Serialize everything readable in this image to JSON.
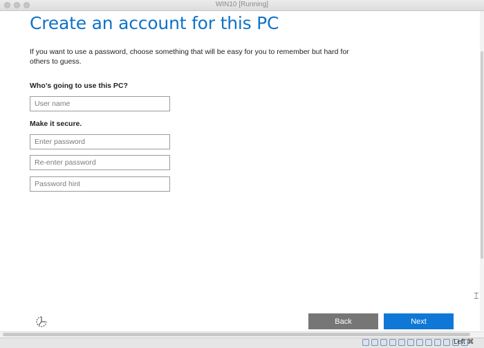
{
  "window": {
    "title": "WIN10 [Running]"
  },
  "page": {
    "title": "Create an account for this PC",
    "intro": "If you want to use a password, choose something that will be easy for you to remember but hard for others to guess.",
    "who_label": "Who’s going to use this PC?",
    "secure_label": "Make it secure."
  },
  "fields": {
    "username": {
      "placeholder": "User name",
      "value": ""
    },
    "password": {
      "placeholder": "Enter password",
      "value": ""
    },
    "reenter": {
      "placeholder": "Re-enter password",
      "value": ""
    },
    "hint": {
      "placeholder": "Password hint",
      "value": ""
    }
  },
  "buttons": {
    "back": "Back",
    "next": "Next"
  },
  "statusbar": {
    "host_key": "Left ⌘",
    "icons": [
      "hard-disk-icon",
      "optical-drive-icon",
      "audio-icon",
      "network-icon",
      "usb-icon",
      "shared-folder-icon",
      "display-icon",
      "video-capture-icon",
      "recording-icon",
      "cpu-icon",
      "mouse-integration-icon",
      "keyboard-icon"
    ]
  },
  "colors": {
    "accent": "#0f72c8",
    "next_button": "#0f78d7",
    "back_button": "#767676"
  }
}
